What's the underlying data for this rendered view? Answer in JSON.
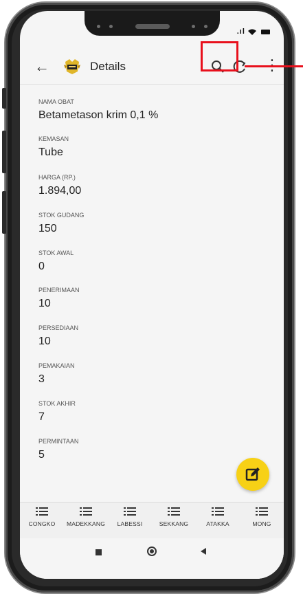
{
  "status_bar": {
    "signal": ".ıl"
  },
  "app_bar": {
    "back_icon": "arrow-left-icon",
    "title": "Details",
    "search_icon": "search-icon",
    "refresh_icon": "refresh-icon",
    "more_icon": "more-vert-icon"
  },
  "fields": [
    {
      "label": "NAMA OBAT",
      "value": "Betametason krim 0,1 %"
    },
    {
      "label": "KEMASAN",
      "value": "Tube"
    },
    {
      "label": "HARGA (Rp.)",
      "value": "1.894,00"
    },
    {
      "label": "STOK GUDANG",
      "value": "150"
    },
    {
      "label": "STOK AWAL",
      "value": "0"
    },
    {
      "label": "PENERIMAAN",
      "value": "10"
    },
    {
      "label": "PERSEDIAAN",
      "value": "10"
    },
    {
      "label": "PEMAKAIAN",
      "value": "3"
    },
    {
      "label": "STOK AKHIR",
      "value": "7"
    },
    {
      "label": "PERMINTAAN",
      "value": "5"
    }
  ],
  "fab": {
    "icon": "edit-icon",
    "color": "#f7d116"
  },
  "bottom_nav": [
    {
      "label": "CONGKO",
      "icon": "list-icon"
    },
    {
      "label": "MADEKKANG",
      "icon": "list-icon"
    },
    {
      "label": "LABESSI",
      "icon": "list-icon"
    },
    {
      "label": "SEKKANG",
      "icon": "list-icon"
    },
    {
      "label": "ATAKKA",
      "icon": "list-icon"
    },
    {
      "label": "MONG",
      "icon": "list-icon"
    }
  ],
  "annotation": {
    "color": "#e8101c"
  }
}
